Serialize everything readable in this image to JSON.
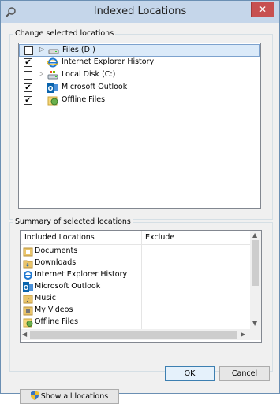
{
  "window": {
    "title": "Indexed Locations",
    "close_glyph": "✕"
  },
  "locations_group": {
    "label": "Change selected locations",
    "items": [
      {
        "label": "Files (D:)",
        "checked": false,
        "expandable": true,
        "selected": true,
        "icon": "removable-drive-icon"
      },
      {
        "label": "Internet Explorer History",
        "checked": true,
        "expandable": false,
        "selected": false,
        "icon": "internet-explorer-icon"
      },
      {
        "label": "Local Disk (C:)",
        "checked": false,
        "expandable": true,
        "selected": false,
        "icon": "hard-drive-icon"
      },
      {
        "label": "Microsoft Outlook",
        "checked": true,
        "expandable": false,
        "selected": false,
        "icon": "outlook-icon"
      },
      {
        "label": "Offline Files",
        "checked": true,
        "expandable": false,
        "selected": false,
        "icon": "offline-files-icon"
      }
    ],
    "check_glyph": "✔",
    "expand_glyph": "▷"
  },
  "summary_group": {
    "label": "Summary of selected locations",
    "columns": [
      "Included Locations",
      "Exclude"
    ],
    "items": [
      {
        "label": "Documents",
        "icon": "library-folder-icon"
      },
      {
        "label": "Downloads",
        "icon": "folder-icon"
      },
      {
        "label": "Internet Explorer History",
        "icon": "internet-explorer-icon"
      },
      {
        "label": "Microsoft Outlook",
        "icon": "outlook-icon"
      },
      {
        "label": "Music",
        "icon": "library-folder-icon"
      },
      {
        "label": "My Videos",
        "icon": "library-folder-icon"
      },
      {
        "label": "Offline Files",
        "icon": "offline-files-icon"
      }
    ]
  },
  "buttons": {
    "show_all": "Show all locations",
    "ok": "OK",
    "cancel": "Cancel"
  },
  "colors": {
    "titlebar": "#c5d6ea",
    "close": "#c75050",
    "selection": "#dbeaf9"
  }
}
